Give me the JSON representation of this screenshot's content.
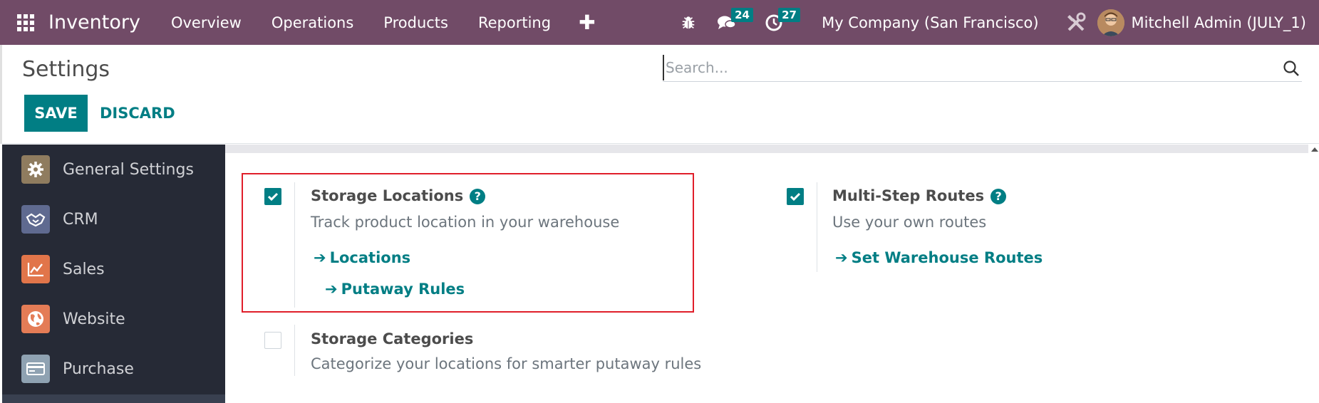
{
  "navbar": {
    "app_name": "Inventory",
    "menu": [
      "Overview",
      "Operations",
      "Products",
      "Reporting"
    ],
    "messages_count": "24",
    "activities_count": "27",
    "company": "My Company (San Francisco)",
    "user": "Mitchell Admin (JULY_1)"
  },
  "control_panel": {
    "title": "Settings",
    "save_label": "SAVE",
    "discard_label": "DISCARD",
    "search_placeholder": "Search..."
  },
  "sidebar": {
    "items": [
      {
        "label": "General Settings",
        "icon": "gear-icon",
        "color": "#8f7c5f"
      },
      {
        "label": "CRM",
        "icon": "handshake-icon",
        "color": "#5f6a90"
      },
      {
        "label": "Sales",
        "icon": "chart-line-icon",
        "color": "#e1754a"
      },
      {
        "label": "Website",
        "icon": "globe-icon",
        "color": "#e47c56"
      },
      {
        "label": "Purchase",
        "icon": "credit-card-icon",
        "color": "#8fa2b2"
      }
    ]
  },
  "settings": {
    "storage_locations": {
      "title": "Storage Locations",
      "description": "Track product location in your warehouse",
      "checked": true,
      "links": [
        "Locations",
        "Putaway Rules"
      ]
    },
    "multi_step_routes": {
      "title": "Multi-Step Routes",
      "description": "Use your own routes",
      "checked": true,
      "links": [
        "Set Warehouse Routes"
      ]
    },
    "storage_categories": {
      "title": "Storage Categories",
      "description": "Categorize your locations for smarter putaway rules",
      "checked": false
    }
  },
  "colors": {
    "navbar": "#714b67",
    "accent": "#017e84",
    "sidebar": "#262a36",
    "highlight": "#e01e2a"
  }
}
